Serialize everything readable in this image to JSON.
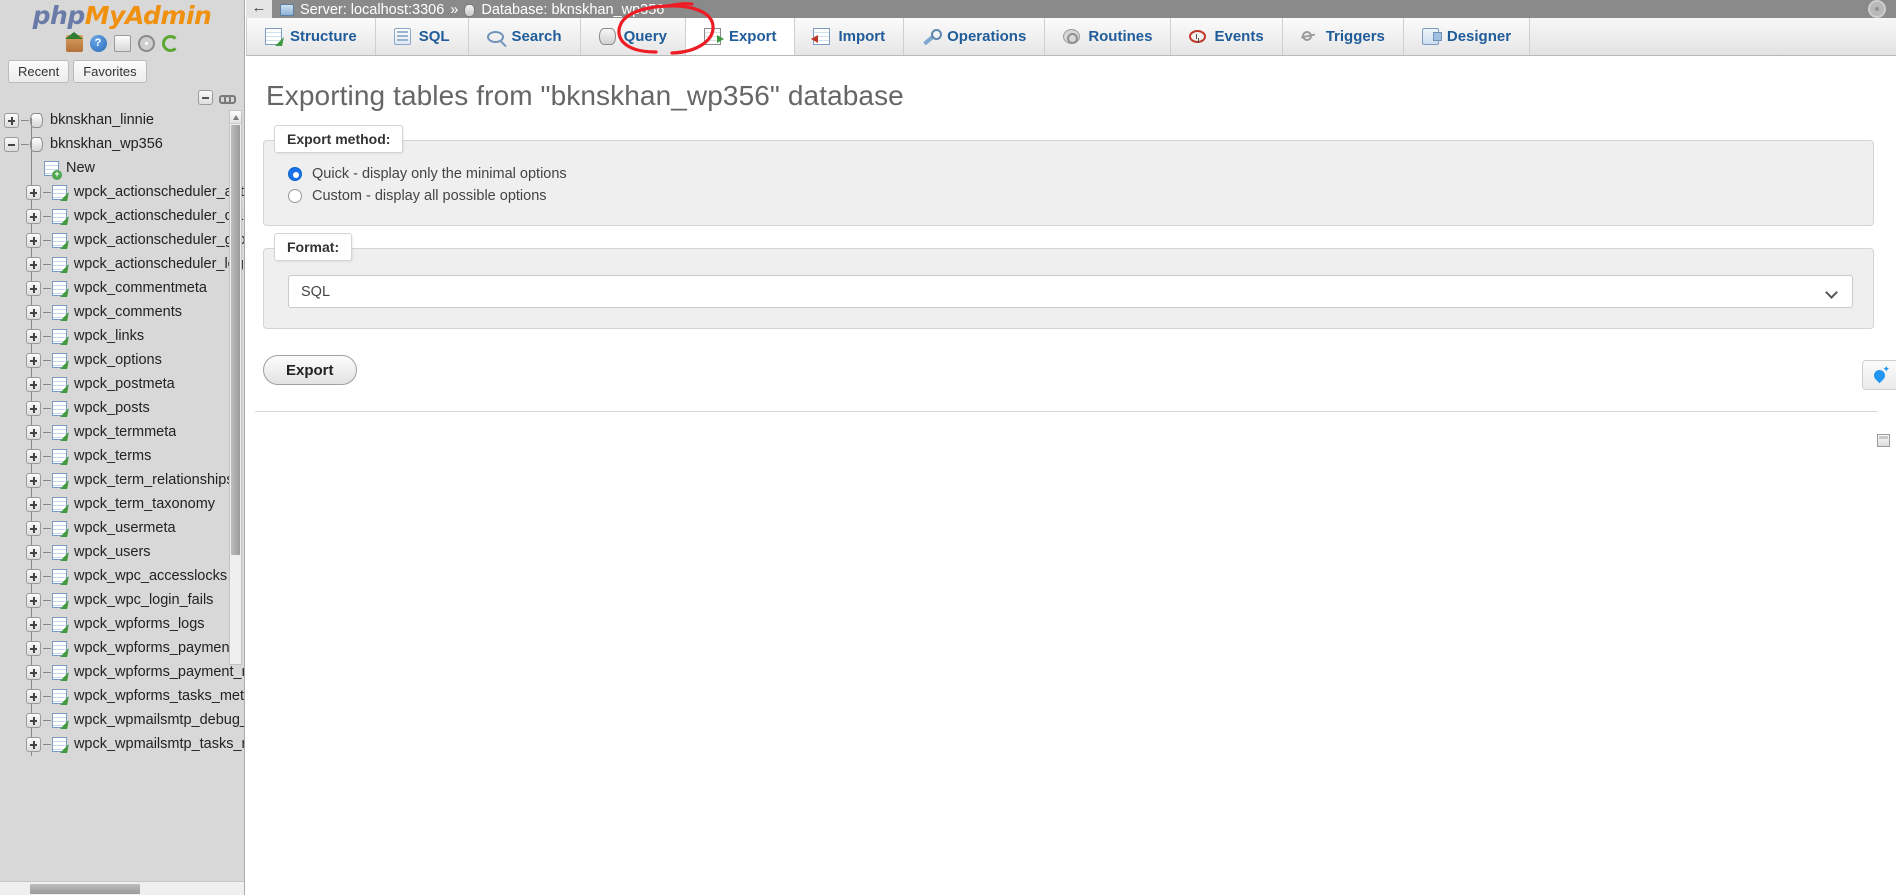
{
  "brand": {
    "php": "php",
    "my": "My",
    "admin": "Admin",
    "icons": [
      "home-icon",
      "help-icon",
      "documentation-icon",
      "settings-gear-icon",
      "reload-icon"
    ]
  },
  "sidebar": {
    "panel_tabs": [
      {
        "label": "Recent"
      },
      {
        "label": "Favorites"
      }
    ],
    "tree": [
      {
        "label": "bknskhan_linnie",
        "type": "database",
        "expanded": false
      },
      {
        "label": "bknskhan_wp356",
        "type": "database",
        "expanded": true
      },
      {
        "label": "New",
        "type": "new"
      },
      {
        "label": "wpck_actionscheduler_acti",
        "type": "table"
      },
      {
        "label": "wpck_actionscheduler_clai",
        "type": "table"
      },
      {
        "label": "wpck_actionscheduler_gro",
        "type": "table"
      },
      {
        "label": "wpck_actionscheduler_logs",
        "type": "table"
      },
      {
        "label": "wpck_commentmeta",
        "type": "table"
      },
      {
        "label": "wpck_comments",
        "type": "table"
      },
      {
        "label": "wpck_links",
        "type": "table"
      },
      {
        "label": "wpck_options",
        "type": "table"
      },
      {
        "label": "wpck_postmeta",
        "type": "table"
      },
      {
        "label": "wpck_posts",
        "type": "table"
      },
      {
        "label": "wpck_termmeta",
        "type": "table"
      },
      {
        "label": "wpck_terms",
        "type": "table"
      },
      {
        "label": "wpck_term_relationships",
        "type": "table"
      },
      {
        "label": "wpck_term_taxonomy",
        "type": "table"
      },
      {
        "label": "wpck_usermeta",
        "type": "table"
      },
      {
        "label": "wpck_users",
        "type": "table"
      },
      {
        "label": "wpck_wpc_accesslocks",
        "type": "table"
      },
      {
        "label": "wpck_wpc_login_fails",
        "type": "table"
      },
      {
        "label": "wpck_wpforms_logs",
        "type": "table"
      },
      {
        "label": "wpck_wpforms_payments",
        "type": "table"
      },
      {
        "label": "wpck_wpforms_payment_r",
        "type": "table"
      },
      {
        "label": "wpck_wpforms_tasks_met",
        "type": "table"
      },
      {
        "label": "wpck_wpmailsmtp_debug_",
        "type": "table"
      },
      {
        "label": "wpck_wpmailsmtp_tasks_r",
        "type": "table"
      }
    ]
  },
  "breadcrumb": {
    "back_glyph": "←",
    "server_label": "Server: localhost:3306",
    "separator": "»",
    "database_label": "Database: bknskhan_wp356"
  },
  "tabs": [
    {
      "label": "Structure",
      "icon": "structure-icon",
      "active": false
    },
    {
      "label": "SQL",
      "icon": "sql-icon",
      "active": false
    },
    {
      "label": "Search",
      "icon": "search-icon",
      "active": false
    },
    {
      "label": "Query",
      "icon": "query-icon",
      "active": false
    },
    {
      "label": "Export",
      "icon": "export-icon",
      "active": true
    },
    {
      "label": "Import",
      "icon": "import-icon",
      "active": false
    },
    {
      "label": "Operations",
      "icon": "operations-wrench-icon",
      "active": false
    },
    {
      "label": "Routines",
      "icon": "routines-gears-icon",
      "active": false
    },
    {
      "label": "Events",
      "icon": "events-clock-icon",
      "active": false
    },
    {
      "label": "Triggers",
      "icon": "triggers-icon",
      "active": false
    },
    {
      "label": "Designer",
      "icon": "designer-icon",
      "active": false
    }
  ],
  "annotation": {
    "shape": "hand-drawn-red-ellipse",
    "color": "#ee1c25",
    "target": "Export"
  },
  "main": {
    "page_title": "Exporting tables from \"bknskhan_wp356\" database",
    "export_method": {
      "legend": "Export method:",
      "options": [
        {
          "label": "Quick - display only the minimal options",
          "checked": true
        },
        {
          "label": "Custom - display all possible options",
          "checked": false
        }
      ]
    },
    "format": {
      "legend": "Format:",
      "selected": "SQL",
      "options": [
        "SQL"
      ]
    },
    "export_button": "Export"
  },
  "widgets": {
    "drop_icon": "water-drop-icon",
    "console_icon": "console-icon",
    "settings_icon": "settings-gear-icon"
  }
}
